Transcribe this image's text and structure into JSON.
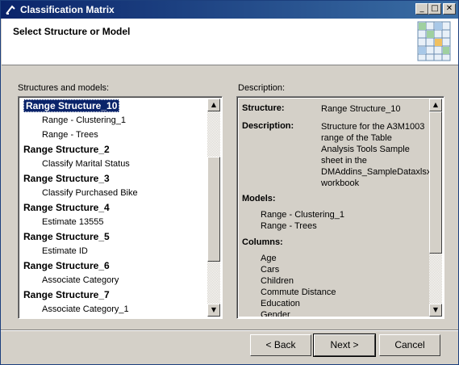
{
  "window": {
    "title": "Classification Matrix",
    "minimize": "_",
    "maximize": "□",
    "close": "✕"
  },
  "header": {
    "heading": "Select Structure or Model"
  },
  "structures": {
    "label": "Structures and models:",
    "items": [
      {
        "label": "Range Structure_10",
        "kind": "structure",
        "selected": true
      },
      {
        "label": "Range - Clustering_1",
        "kind": "model"
      },
      {
        "label": "Range - Trees",
        "kind": "model"
      },
      {
        "label": "Range Structure_2",
        "kind": "structure"
      },
      {
        "label": "Classify Marital Status",
        "kind": "model"
      },
      {
        "label": "Range Structure_3",
        "kind": "structure"
      },
      {
        "label": "Classify Purchased Bike",
        "kind": "model"
      },
      {
        "label": "Range Structure_4",
        "kind": "structure"
      },
      {
        "label": "Estimate 13555",
        "kind": "model"
      },
      {
        "label": "Range Structure_5",
        "kind": "structure"
      },
      {
        "label": "Estimate ID",
        "kind": "model"
      },
      {
        "label": "Range Structure_6",
        "kind": "structure"
      },
      {
        "label": "Associate Category",
        "kind": "model"
      },
      {
        "label": "Range Structure_7",
        "kind": "structure"
      },
      {
        "label": "Associate Category_1",
        "kind": "model"
      }
    ],
    "scroll_position": 0.0
  },
  "description": {
    "label": "Description:",
    "structure_key": "Structure:",
    "structure_value": "Range Structure_10",
    "description_key": "Description:",
    "description_lines": [
      "Structure for the A3M1003",
      "range of the Table",
      "Analysis Tools Sample",
      "sheet in the",
      "DMAddins_SampleDataxlsx",
      "workbook"
    ],
    "models_heading": "Models:",
    "models": [
      "Range - Clustering_1",
      "Range - Trees"
    ],
    "columns_heading": "Columns:",
    "columns": [
      "Age",
      "Cars",
      "Children",
      "Commute Distance",
      "Education",
      "Gender"
    ]
  },
  "buttons": {
    "back": "< Back",
    "next": "Next >",
    "cancel": "Cancel"
  },
  "colors": {
    "selection": "#0a246a",
    "titlebar_start": "#0a246a",
    "titlebar_end": "#3a6ea5",
    "face": "#d4d0c8"
  }
}
